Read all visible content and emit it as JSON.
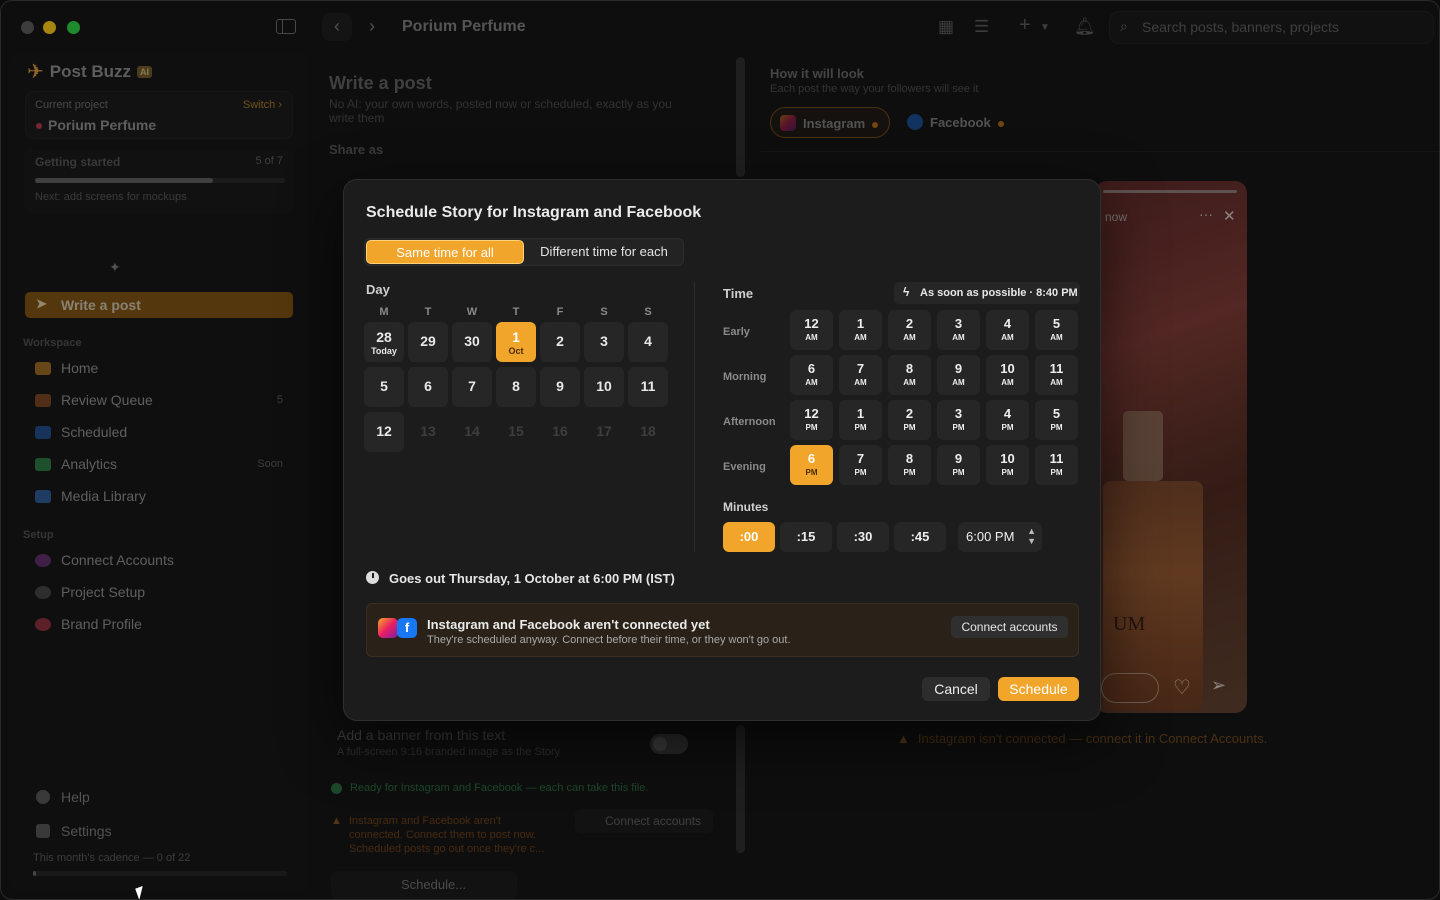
{
  "window": {
    "title": "Porium Perfume"
  },
  "search": {
    "placeholder": "Search posts, banners, projects"
  },
  "sidebar": {
    "logo_text": "Post Buzz",
    "logo_badge": "AI",
    "project": {
      "label": "Current project",
      "switch_label": "Switch ›",
      "name": "Porium Perfume"
    },
    "getting_started": {
      "title": "Getting started",
      "count": "5 of 7",
      "progress": 0.71,
      "next": "Next: add screens for mockups"
    },
    "write_post_label": "Write a post",
    "workspace_label": "Workspace",
    "workspace_items": [
      {
        "label": "Home",
        "count": ""
      },
      {
        "label": "Review Queue",
        "count": "5"
      },
      {
        "label": "Scheduled",
        "count": ""
      },
      {
        "label": "Analytics",
        "count": "Soon"
      },
      {
        "label": "Media Library",
        "count": ""
      }
    ],
    "setup_label": "Setup",
    "setup_items": [
      {
        "label": "Connect Accounts"
      },
      {
        "label": "Project Setup"
      },
      {
        "label": "Brand Profile"
      }
    ],
    "help_label": "Help",
    "settings_label": "Settings",
    "cadence": {
      "label": "This month's cadence — 0 of 22",
      "progress": 0
    }
  },
  "composer": {
    "title": "Write a post",
    "subtitle": "No AI: your own words, posted now or scheduled, exactly as you write them",
    "share_label": "Share as",
    "banner_title": "Add a banner from this text",
    "banner_sub": "A full-screen 9:16 branded image as the Story",
    "ready_text": "Ready for Instagram and Facebook — each can take this file.",
    "warn_text": "Instagram and Facebook aren't connected. Connect them to post now. Scheduled posts go out once they're c...",
    "connect_label": "Connect accounts",
    "schedule_label": "Schedule..."
  },
  "preview": {
    "title": "How it will look",
    "subtitle": "Each post the way your followers will see it",
    "chips": [
      {
        "label": "Instagram"
      },
      {
        "label": "Facebook"
      }
    ],
    "story_time": "now",
    "bottle_label": "UM",
    "ig_warning": "Instagram isn't connected — connect it in Connect Accounts."
  },
  "modal": {
    "title": "Schedule Story for Instagram and Facebook",
    "seg_same": "Same time for all",
    "seg_diff": "Different time for each",
    "day_label": "Day",
    "weekdays": [
      "M",
      "T",
      "W",
      "T",
      "F",
      "S",
      "S"
    ],
    "days": [
      {
        "n": "28",
        "sub": "Today",
        "state": "today"
      },
      {
        "n": "29",
        "sub": "",
        "state": "normal"
      },
      {
        "n": "30",
        "sub": "",
        "state": "normal"
      },
      {
        "n": "1",
        "sub": "Oct",
        "state": "selected"
      },
      {
        "n": "2",
        "sub": "",
        "state": "normal"
      },
      {
        "n": "3",
        "sub": "",
        "state": "normal"
      },
      {
        "n": "4",
        "sub": "",
        "state": "normal"
      },
      {
        "n": "5",
        "sub": "",
        "state": "normal"
      },
      {
        "n": "6",
        "sub": "",
        "state": "normal"
      },
      {
        "n": "7",
        "sub": "",
        "state": "normal"
      },
      {
        "n": "8",
        "sub": "",
        "state": "normal"
      },
      {
        "n": "9",
        "sub": "",
        "state": "normal"
      },
      {
        "n": "10",
        "sub": "",
        "state": "normal"
      },
      {
        "n": "11",
        "sub": "",
        "state": "normal"
      },
      {
        "n": "12",
        "sub": "",
        "state": "normal"
      },
      {
        "n": "13",
        "sub": "",
        "state": "disabled"
      },
      {
        "n": "14",
        "sub": "",
        "state": "disabled"
      },
      {
        "n": "15",
        "sub": "",
        "state": "disabled"
      },
      {
        "n": "16",
        "sub": "",
        "state": "disabled"
      },
      {
        "n": "17",
        "sub": "",
        "state": "disabled"
      },
      {
        "n": "18",
        "sub": "",
        "state": "disabled"
      }
    ],
    "time_label": "Time",
    "asap_label": "As soon as possible · 8:40 PM",
    "rows": [
      {
        "label": "Early",
        "hours": [
          {
            "n": "12",
            "s": "AM"
          },
          {
            "n": "1",
            "s": "AM"
          },
          {
            "n": "2",
            "s": "AM"
          },
          {
            "n": "3",
            "s": "AM"
          },
          {
            "n": "4",
            "s": "AM"
          },
          {
            "n": "5",
            "s": "AM"
          }
        ]
      },
      {
        "label": "Morning",
        "hours": [
          {
            "n": "6",
            "s": "AM"
          },
          {
            "n": "7",
            "s": "AM"
          },
          {
            "n": "8",
            "s": "AM"
          },
          {
            "n": "9",
            "s": "AM"
          },
          {
            "n": "10",
            "s": "AM"
          },
          {
            "n": "11",
            "s": "AM"
          }
        ]
      },
      {
        "label": "Afternoon",
        "hours": [
          {
            "n": "12",
            "s": "PM"
          },
          {
            "n": "1",
            "s": "PM"
          },
          {
            "n": "2",
            "s": "PM"
          },
          {
            "n": "3",
            "s": "PM"
          },
          {
            "n": "4",
            "s": "PM"
          },
          {
            "n": "5",
            "s": "PM"
          }
        ]
      },
      {
        "label": "Evening",
        "hours": [
          {
            "n": "6",
            "s": "PM",
            "sel": true
          },
          {
            "n": "7",
            "s": "PM"
          },
          {
            "n": "8",
            "s": "PM"
          },
          {
            "n": "9",
            "s": "PM"
          },
          {
            "n": "10",
            "s": "PM"
          },
          {
            "n": "11",
            "s": "PM"
          }
        ]
      }
    ],
    "minutes_label": "Minutes",
    "minutes": [
      {
        "v": ":00",
        "sel": true
      },
      {
        "v": ":15"
      },
      {
        "v": ":30"
      },
      {
        "v": ":45"
      }
    ],
    "time_value": "6:00 PM",
    "goes_out": "Goes out Thursday, 1 October at 6:00 PM (IST)",
    "notice_title": "Instagram and Facebook aren't connected yet",
    "notice_sub": "They're scheduled anyway. Connect before their time, or they won't go out.",
    "notice_button": "Connect accounts",
    "cancel_label": "Cancel",
    "schedule_label": "Schedule"
  },
  "colors": {
    "accent": "#f2a52b",
    "warning": "#a7661a"
  }
}
